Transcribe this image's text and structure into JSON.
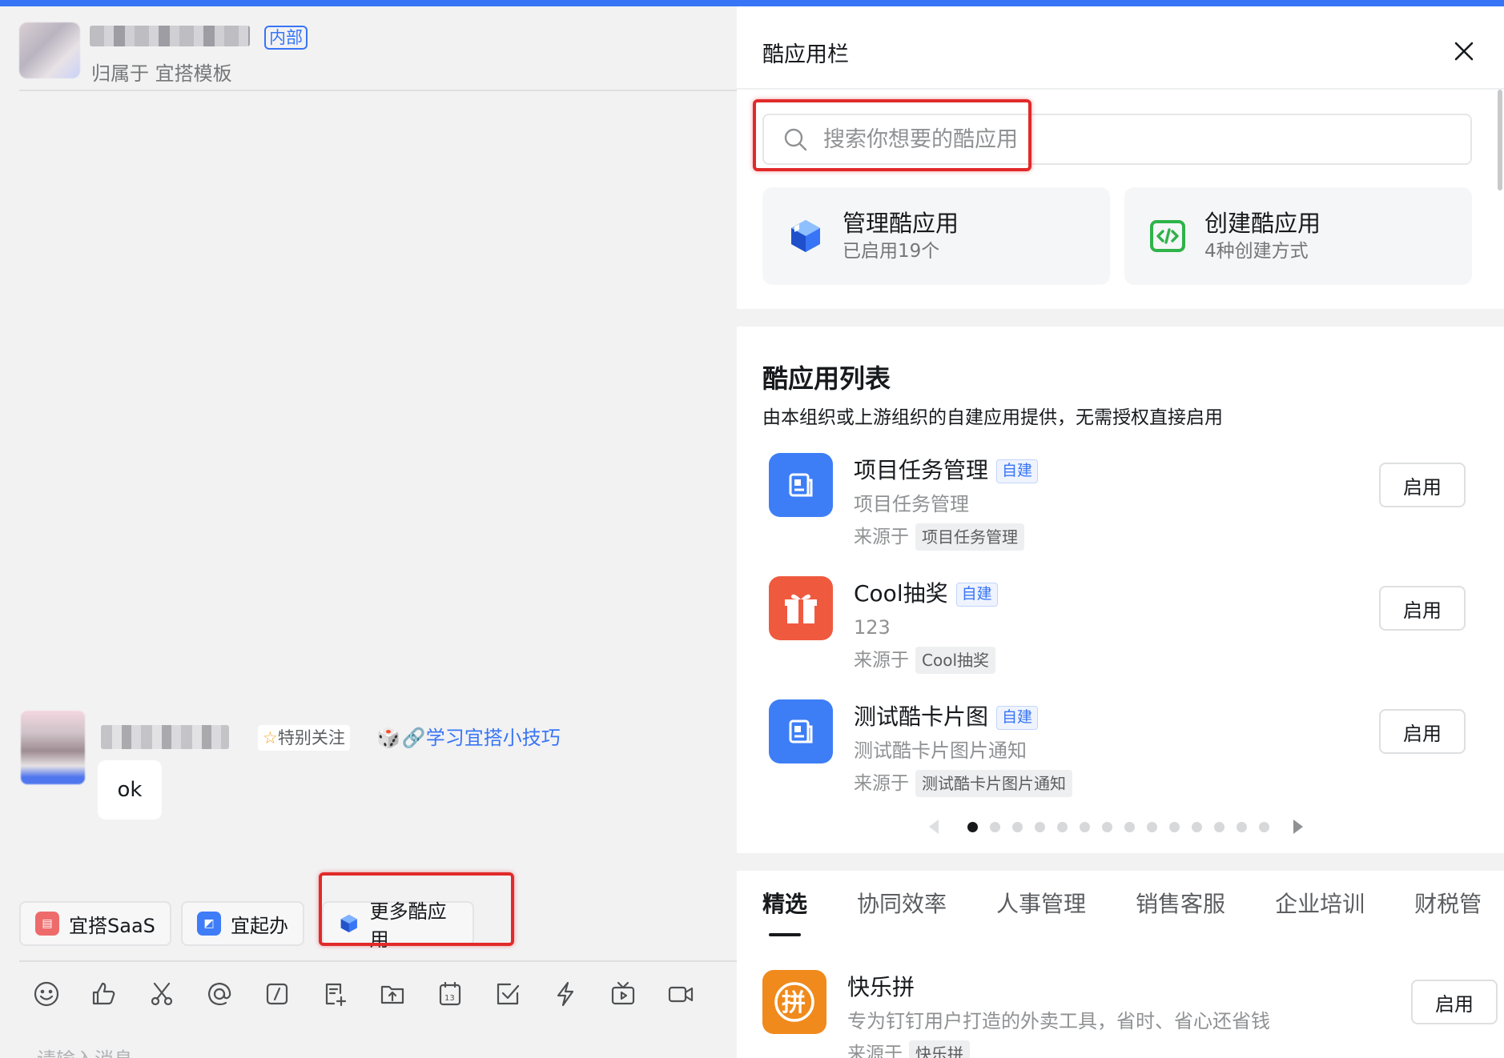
{
  "chat": {
    "group_tag": "内部",
    "group_belong": "归属于 宜搭模板",
    "follow_tag": "特别关注",
    "tip_link": "🔗学习宜搭小技巧",
    "message_text": "ok",
    "quick_buttons": [
      "宜搭SaaS",
      "宜起办",
      "更多酷应用"
    ],
    "input_placeholder": "请输入消息"
  },
  "panel": {
    "title": "酷应用栏",
    "search_placeholder": "搜索你想要的酷应用",
    "cards": [
      {
        "title": "管理酷应用",
        "sub": "已启用19个"
      },
      {
        "title": "创建酷应用",
        "sub": "4种创建方式"
      }
    ],
    "list_title": "酷应用列表",
    "list_desc": "由本组织或上游组织的自建应用提供，无需授权直接启用",
    "source_prefix": "来源于",
    "enable_label": "启用",
    "apps": [
      {
        "name": "项目任务管理",
        "tag": "自建",
        "desc": "项目任务管理",
        "source": "项目任务管理"
      },
      {
        "name": "Cool抽奖",
        "tag": "自建",
        "desc": "123",
        "source": "Cool抽奖"
      },
      {
        "name": "测试酷卡片图",
        "tag": "自建",
        "desc": "测试酷卡片图片通知",
        "source": "测试酷卡片图片通知"
      }
    ],
    "pager": {
      "total": 14,
      "current": 1
    },
    "tabs": [
      "精选",
      "协同效率",
      "人事管理",
      "销售客服",
      "企业培训",
      "财税管"
    ],
    "featured": {
      "name": "快乐拼",
      "desc": "专为钉钉用户打造的外卖工具，省时、省心还省钱",
      "source_prefix": "来源于",
      "source": "快乐拼"
    }
  },
  "colors": {
    "accent": "#3875f6",
    "highlight_frame": "#e12a2a"
  }
}
